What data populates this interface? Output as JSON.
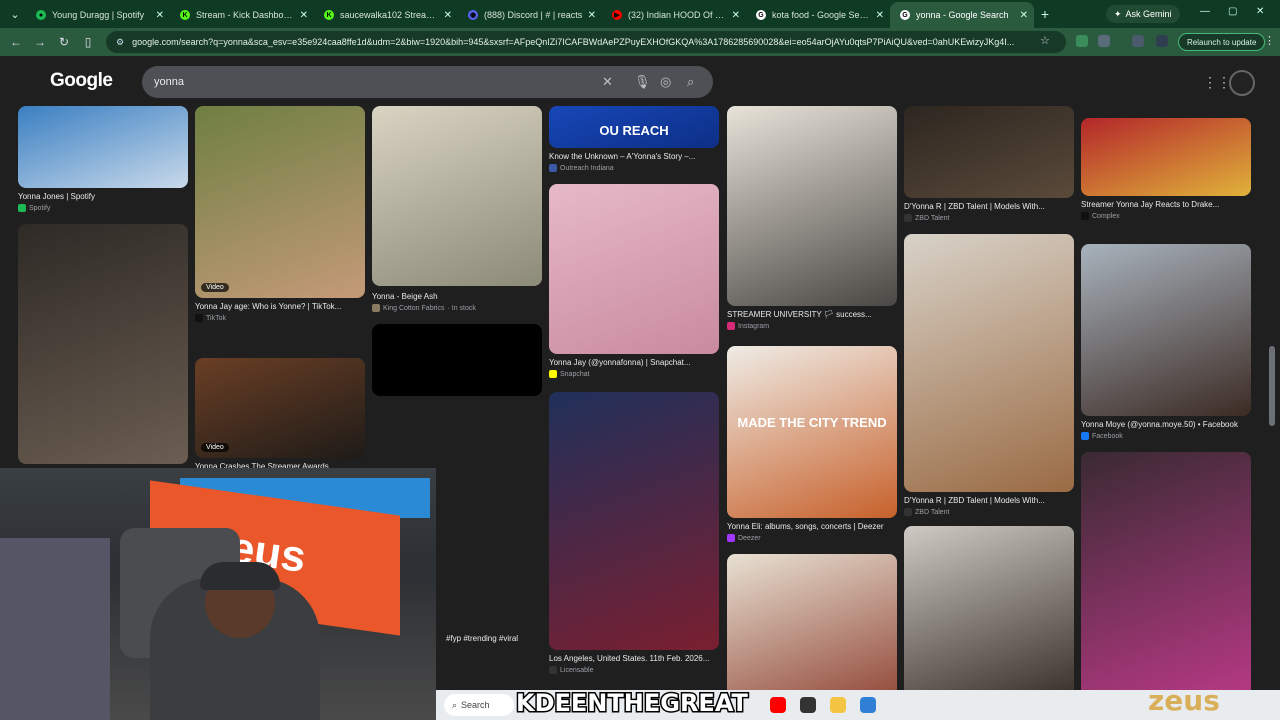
{
  "browser": {
    "tabs": [
      {
        "title": "Young Duragg | Spotify",
        "color": "#1db954",
        "glyph": "●",
        "active": false
      },
      {
        "title": "Stream - Kick Dashboard",
        "color": "#53fc18",
        "glyph": "K",
        "active": false
      },
      {
        "title": "saucewalka102 Stream - Ki",
        "color": "#53fc18",
        "glyph": "K",
        "active": false
      },
      {
        "title": "(888) Discord | # | reacts",
        "color": "#5865f2",
        "glyph": "◉",
        "active": false
      },
      {
        "title": "(32) Indian HOOD Of Durb",
        "color": "#ff0000",
        "glyph": "▶",
        "active": false
      },
      {
        "title": "kota food - Google Search",
        "color": "#ffffff",
        "glyph": "G",
        "active": false
      },
      {
        "title": "yonna - Google Search",
        "color": "#ffffff",
        "glyph": "G",
        "active": true
      }
    ],
    "new_tab_glyph": "+",
    "ask_gemini": "Ask Gemini",
    "url": "google.com/search?q=yonna&sca_esv=e35e924caa8ffe1d&udm=2&biw=1920&bih=945&sxsrf=AFpeQnIZi7ICAFBWdAePZPuyEXHOfGKQA%3A1786285690028&ei=eo54arOjAYu0qtsP7PiAiQU&ved=0ahUKEwizyJKg4I...",
    "relaunch": "Relaunch to update"
  },
  "google": {
    "logo": "Google",
    "query": "yonna"
  },
  "results": [
    {
      "caption": "Yonna Jones | Spotify",
      "source": "Spotify",
      "src_color": "#1db954",
      "img_colors": [
        "#3a7fc2",
        "#c8d9ea"
      ],
      "video": false
    },
    {
      "caption": "",
      "source": "",
      "src_color": "#000",
      "img_colors": [
        "#2e2a26",
        "#6b5d51"
      ],
      "video": false
    },
    {
      "caption": "Yonna Jay age: Who is Yonne? | TikTok...",
      "source": "TikTok",
      "src_color": "#111111",
      "img_colors": [
        "#6e7f42",
        "#c49a78"
      ],
      "video": true,
      "video_label": "Video"
    },
    {
      "caption": "Yonna Crashes The Streamer Awards...",
      "source": "",
      "src_color": "#000",
      "img_colors": [
        "#6a3f25",
        "#1f1b18"
      ],
      "video": true,
      "video_label": "Video"
    },
    {
      "caption": "Yonna - Beige Ash",
      "source": "King Cotton Fabrics",
      "stock": "· In stock",
      "src_color": "#8a7a62",
      "img_colors": [
        "#d9d3c2",
        "#8c8a78"
      ],
      "video": false
    },
    {
      "caption": "",
      "source": "",
      "src_color": "#000",
      "img_colors": [
        "#000000",
        "#000000"
      ],
      "video": false
    },
    {
      "caption": "Know the Unknown – A'Yonna's Story –...",
      "source": "Outreach Indiana",
      "src_color": "#3b5ba9",
      "img_colors": [
        "#1747b8",
        "#0d2f86"
      ],
      "video": false,
      "overlay": "OU  REACH"
    },
    {
      "caption": "Yonna Jay (@yonnafonna) | Snapchat...",
      "source": "Snapchat",
      "src_color": "#fffc00",
      "img_colors": [
        "#e6b9c8",
        "#c98aa0"
      ],
      "video": false
    },
    {
      "caption": "Los Angeles, United States. 11th Feb. 2026...",
      "source": "Licensable",
      "src_color": "#333",
      "img_colors": [
        "#20305a",
        "#7a1f30"
      ],
      "video": false
    },
    {
      "caption": "STREAMER UNIVERSITY 🏳 success...",
      "source": "Instagram",
      "src_color": "#d62976",
      "img_colors": [
        "#e8e3d9",
        "#4a4744"
      ],
      "video": false
    },
    {
      "caption": "Yonna Eli: albums, songs, concerts | Deezer",
      "source": "Deezer",
      "src_color": "#a238ff",
      "img_colors": [
        "#efece6",
        "#c7612b"
      ],
      "video": false,
      "overlay": "MADE THE CITY TREND"
    },
    {
      "caption": "",
      "source": "",
      "src_color": "#000",
      "img_colors": [
        "#e8e1d3",
        "#8a3a2a"
      ],
      "video": false
    },
    {
      "caption": "D'Yonna R | ZBD Talent | Models With...",
      "source": "ZBD Talent",
      "src_color": "#333",
      "img_colors": [
        "#2d2620",
        "#5a4a3a"
      ],
      "video": false
    },
    {
      "caption": "D'Yonna R | ZBD Talent | Models With...",
      "source": "ZBD Talent",
      "src_color": "#333",
      "img_colors": [
        "#d8d2c8",
        "#9a6b44"
      ],
      "video": false
    },
    {
      "caption": "",
      "source": "",
      "src_color": "#000",
      "img_colors": [
        "#cfcac4",
        "#2a211b"
      ],
      "video": false
    },
    {
      "caption": "Streamer Yonna Jay Reacts to Drake...",
      "source": "Complex",
      "src_color": "#111",
      "img_colors": [
        "#b3262a",
        "#e0b23a"
      ],
      "video": false
    },
    {
      "caption": "Yonna Moye (@yonna.moye.50) • Facebook",
      "source": "Facebook",
      "src_color": "#1877f2",
      "img_colors": [
        "#a8b3bd",
        "#3c2b24"
      ],
      "video": false
    },
    {
      "caption": "",
      "source": "",
      "src_color": "#000",
      "img_colors": [
        "#3a2a33",
        "#c03a8a"
      ],
      "video": false
    }
  ],
  "video_caption": "#fyp #trending #viral",
  "stream_overlay": {
    "streamer_name": "KDEENTHEGREAT",
    "corner_brand": "zeus",
    "banner_text": "eus",
    "taskbar_search": "Search"
  }
}
